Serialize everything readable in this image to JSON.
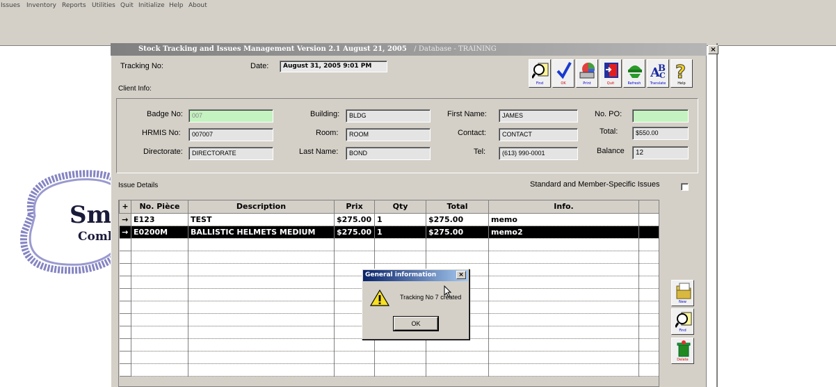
{
  "menu": [
    "Issues",
    "Inventory",
    "Reports",
    "Utilities",
    "Quit",
    "Initialize",
    "Help",
    "About"
  ],
  "background_logo": {
    "line1": "Sm",
    "line2": "Comb"
  },
  "window": {
    "title": "Stock Tracking and Issues Management Version 2.1 August 21, 2005",
    "database": "/ Database - TRAINING",
    "close_glyph": "×"
  },
  "header": {
    "tracking_label": "Tracking No:",
    "date_label": "Date:",
    "date_value": "August 31, 2005 9:01 PM",
    "client_info_label": "Client Info:"
  },
  "toolbar": [
    {
      "caption": "Find",
      "icon": "find-icon"
    },
    {
      "caption": "OK",
      "icon": "checkmark-icon"
    },
    {
      "caption": "Print",
      "icon": "print-icon"
    },
    {
      "caption": "Quit",
      "icon": "exit-door-icon"
    },
    {
      "caption": "Refresh",
      "icon": "refresh-icon"
    },
    {
      "caption": "Translate",
      "icon": "translate-icon"
    },
    {
      "caption": "Help",
      "icon": "help-icon"
    }
  ],
  "client": {
    "badge_label": "Badge No:",
    "badge_value": "007",
    "hrmis_label": "HRMIS No:",
    "hrmis_value": "007007",
    "directorate_label": "Directorate:",
    "directorate_value": "DIRECTORATE",
    "building_label": "Building:",
    "building_value": "BLDG",
    "room_label": "Room:",
    "room_value": "ROOM",
    "lastname_label": "Last Name:",
    "lastname_value": "BOND",
    "firstname_label": "First Name:",
    "firstname_value": "JAMES",
    "contact_label": "Contact:",
    "contact_value": "CONTACT",
    "tel_label": "Tel:",
    "tel_value": "(613) 990-0001",
    "po_label": "No. PO:",
    "po_value": "",
    "total_label": "Total:",
    "total_value": "$550.00",
    "balance_label": "Balance",
    "balance_value": "12"
  },
  "issue": {
    "details_label": "Issue Details",
    "standard_label": "Standard and Member-Specific Issues"
  },
  "grid": {
    "columns": [
      "+",
      "No. Pièce",
      "Description",
      "Prix",
      "Qty",
      "Total",
      "Info."
    ],
    "rows": [
      {
        "marker": "→",
        "piece": "E123",
        "description": "TEST",
        "prix": "$275.00",
        "qty": "1",
        "total": "$275.00",
        "info": "memo",
        "selected": false
      },
      {
        "marker": "→",
        "piece": "E0200M",
        "description": "BALLISTIC HELMETS MEDIUM",
        "prix": "$275.00",
        "qty": "1",
        "total": "$275.00",
        "info": "memo2",
        "selected": true
      }
    ],
    "empty_rows": 11
  },
  "side_buttons": [
    {
      "caption": "New",
      "icon": "new-folder-icon"
    },
    {
      "caption": "Find",
      "icon": "find-icon"
    },
    {
      "caption": "Delete",
      "icon": "trash-icon"
    }
  ],
  "dialog": {
    "title": "General information",
    "message": "Tracking No 7 created",
    "ok_label": "OK",
    "close_glyph": "×"
  }
}
